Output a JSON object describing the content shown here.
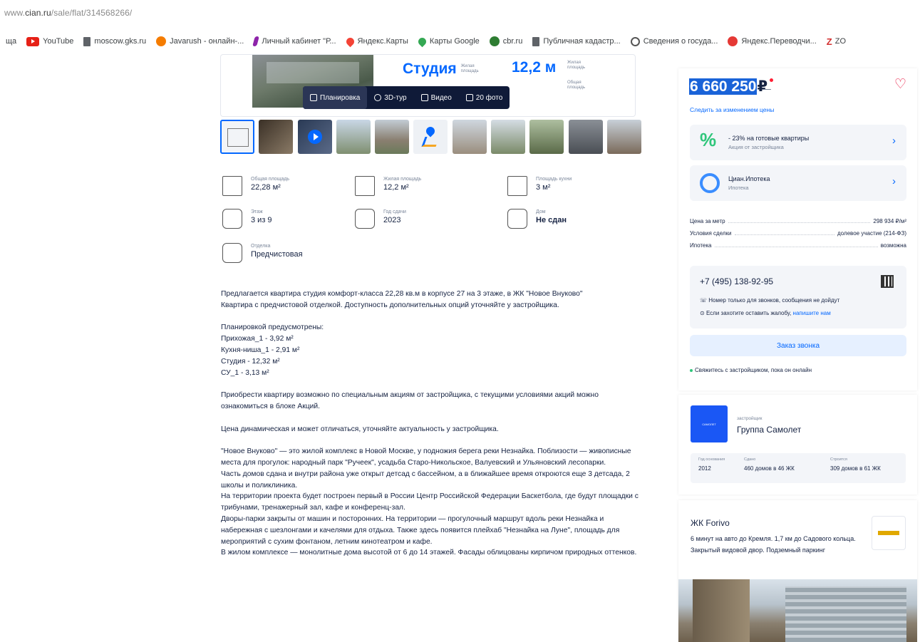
{
  "browser": {
    "url_prefix": "www.",
    "url_domain": "cian.ru",
    "url_path": "/sale/flat/314568266/",
    "bookmarks": [
      {
        "label": "ща",
        "icon": "text"
      },
      {
        "label": "YouTube",
        "icon": "youtube-icon"
      },
      {
        "label": "moscow.gks.ru",
        "icon": "document-icon"
      },
      {
        "label": "Javarush - онлайн-...",
        "icon": "javarush-icon"
      },
      {
        "label": "Личный кабинет \"Р...",
        "icon": "pin-icon"
      },
      {
        "label": "Яндекс.Карты",
        "icon": "map-pin-icon"
      },
      {
        "label": "Карты Google",
        "icon": "google-maps-icon"
      },
      {
        "label": "cbr.ru",
        "icon": "cbr-icon"
      },
      {
        "label": "Публичная кадастр...",
        "icon": "document-icon"
      },
      {
        "label": "Сведения о госуда...",
        "icon": "globe-icon"
      },
      {
        "label": "Яндекс.Переводчи...",
        "icon": "translate-icon"
      },
      {
        "label": "ZO",
        "icon": "z-icon"
      }
    ]
  },
  "gallery": {
    "plan_title": "Студия",
    "plan_title_sub": "Жилая площадь",
    "plan_area": "12,2 м",
    "plan_area_sub": "Жилая площадь",
    "plan_area2_sub": "Общая площадь",
    "media_buttons": [
      "Планировка",
      "3D-тур",
      "Видео",
      "20 фото"
    ],
    "thumbnails": 11
  },
  "params": [
    {
      "label": "Общая площадь",
      "value": "22,28 м²",
      "icon": "total-area-icon"
    },
    {
      "label": "Жилая площадь",
      "value": "12,2 м²",
      "icon": "living-area-icon"
    },
    {
      "label": "Площадь кухни",
      "value": "3 м²",
      "icon": "kitchen-area-icon"
    },
    {
      "label": "Этаж",
      "value": "3 из 9",
      "icon": "floor-icon"
    },
    {
      "label": "Год сдачи",
      "value": "2023",
      "icon": "year-icon"
    },
    {
      "label": "Дом",
      "value": "Не сдан",
      "icon": "house-icon"
    },
    {
      "label": "Отделка",
      "value": "Предчистовая",
      "icon": "finishing-icon"
    }
  ],
  "description": {
    "p1": "Предлагается квартира студия комфорт-класса 22,28 кв.м в корпусе 27 на 3 этаже, в ЖК \"Новое Внуково\"",
    "p2": "Квартира с предчистовой отделкой. Доступность дополнительных опций уточняйте у застройщика.",
    "p3": "Планировкой предусмотрены:",
    "p4": "Прихожая_1 - 3,92 м²",
    "p5": "Кухня-ниша_1 - 2,91 м²",
    "p6": "Студия - 12,32 м²",
    "p7": "СУ_1 - 3,13 м²",
    "p8": "Приобрести квартиру возможно по специальным акциям от застройщика, с текущими условиями акций можно ознакомиться в блоке Акций.",
    "p9": "Цена динамическая и может отличаться, уточняйте актуальность у застройщика.",
    "p10": "\"Новое Внуково\" — это жилой комплекс в Новой Москве, у подножия берега реки Незнайка. Поблизости — живописные места для прогулок: народный парк \"Ручеек\", усадьба Старо-Никольское, Валуевский и Ульяновский лесопарки.",
    "p11": "Часть домов сдана и внутри района уже открыт детсад с бассейном, а в ближайшее время откроются еще 3 детсада, 2 школы и поликлиника.",
    "p12": "На территории проекта будет построен первый в России Центр Российской Федерации Баскетбола, где будут площадки с трибунами, тренажерный зал, кафе и конференц-зал.",
    "p13": "Дворы-парки закрыты от машин и посторонних. На территории — прогулочный маршрут вдоль реки Незнайка и набережная с шезлонгами и качелями для отдыха. Также здесь появится плейхаб \"Незнайка на Луне\", площадь для мероприятий с сухим фонтаном, летним кинотеатром и кафе.",
    "p14": "В жилом комплексе — монолитные дома высотой от 6 до 14 этажей. Фасады облицованы кирпичом природных оттенков."
  },
  "offer": {
    "price": "6 660 250",
    "currency": "₽",
    "watch_link": "Следить за изменением цены",
    "promos": [
      {
        "title": "- 23% на готовые квартиры",
        "sub": "Акция от застройщика",
        "icon": "percent-icon"
      },
      {
        "title": "Циан.Ипотека",
        "sub": "Ипотека",
        "icon": "mortgage-icon"
      }
    ],
    "details": [
      {
        "k": "Цена за метр",
        "v": "298 934 ₽/м²"
      },
      {
        "k": "Условия сделки",
        "v": "долевое участие (214-ФЗ)"
      },
      {
        "k": "Ипотека",
        "v": "возможна"
      }
    ],
    "phone": "+7 (495) 138-92-95",
    "note1": "Номер только для звонков, сообщения не дойдут",
    "note2_prefix": "Если захотите оставить жалобу,",
    "note2_link": "напишите нам",
    "call_button": "Заказ звонка",
    "online_note": "Свяжитесь с застройщиком, пока он онлайн"
  },
  "developer": {
    "logo_text": "САМОЛЕТ",
    "sub": "застройщик",
    "name": "Группа Самолет",
    "stats": [
      {
        "label": "Год основания",
        "value": "2012"
      },
      {
        "label": "Сдано",
        "value": "460 домов в 46 ЖК"
      },
      {
        "label": "Строится",
        "value": "309 домов в 61 ЖК"
      }
    ]
  },
  "ad": {
    "title": "ЖК Forivo",
    "text": "6 минут на авто до Кремля. 1,7 км до Садового кольца. Закрытый видовой двор. Подземный паркинг"
  },
  "colors": {
    "accent": "#0468ff",
    "text": "#152242",
    "muted": "#7a869a",
    "favorite": "#e8113b",
    "success": "#2fc67b"
  }
}
